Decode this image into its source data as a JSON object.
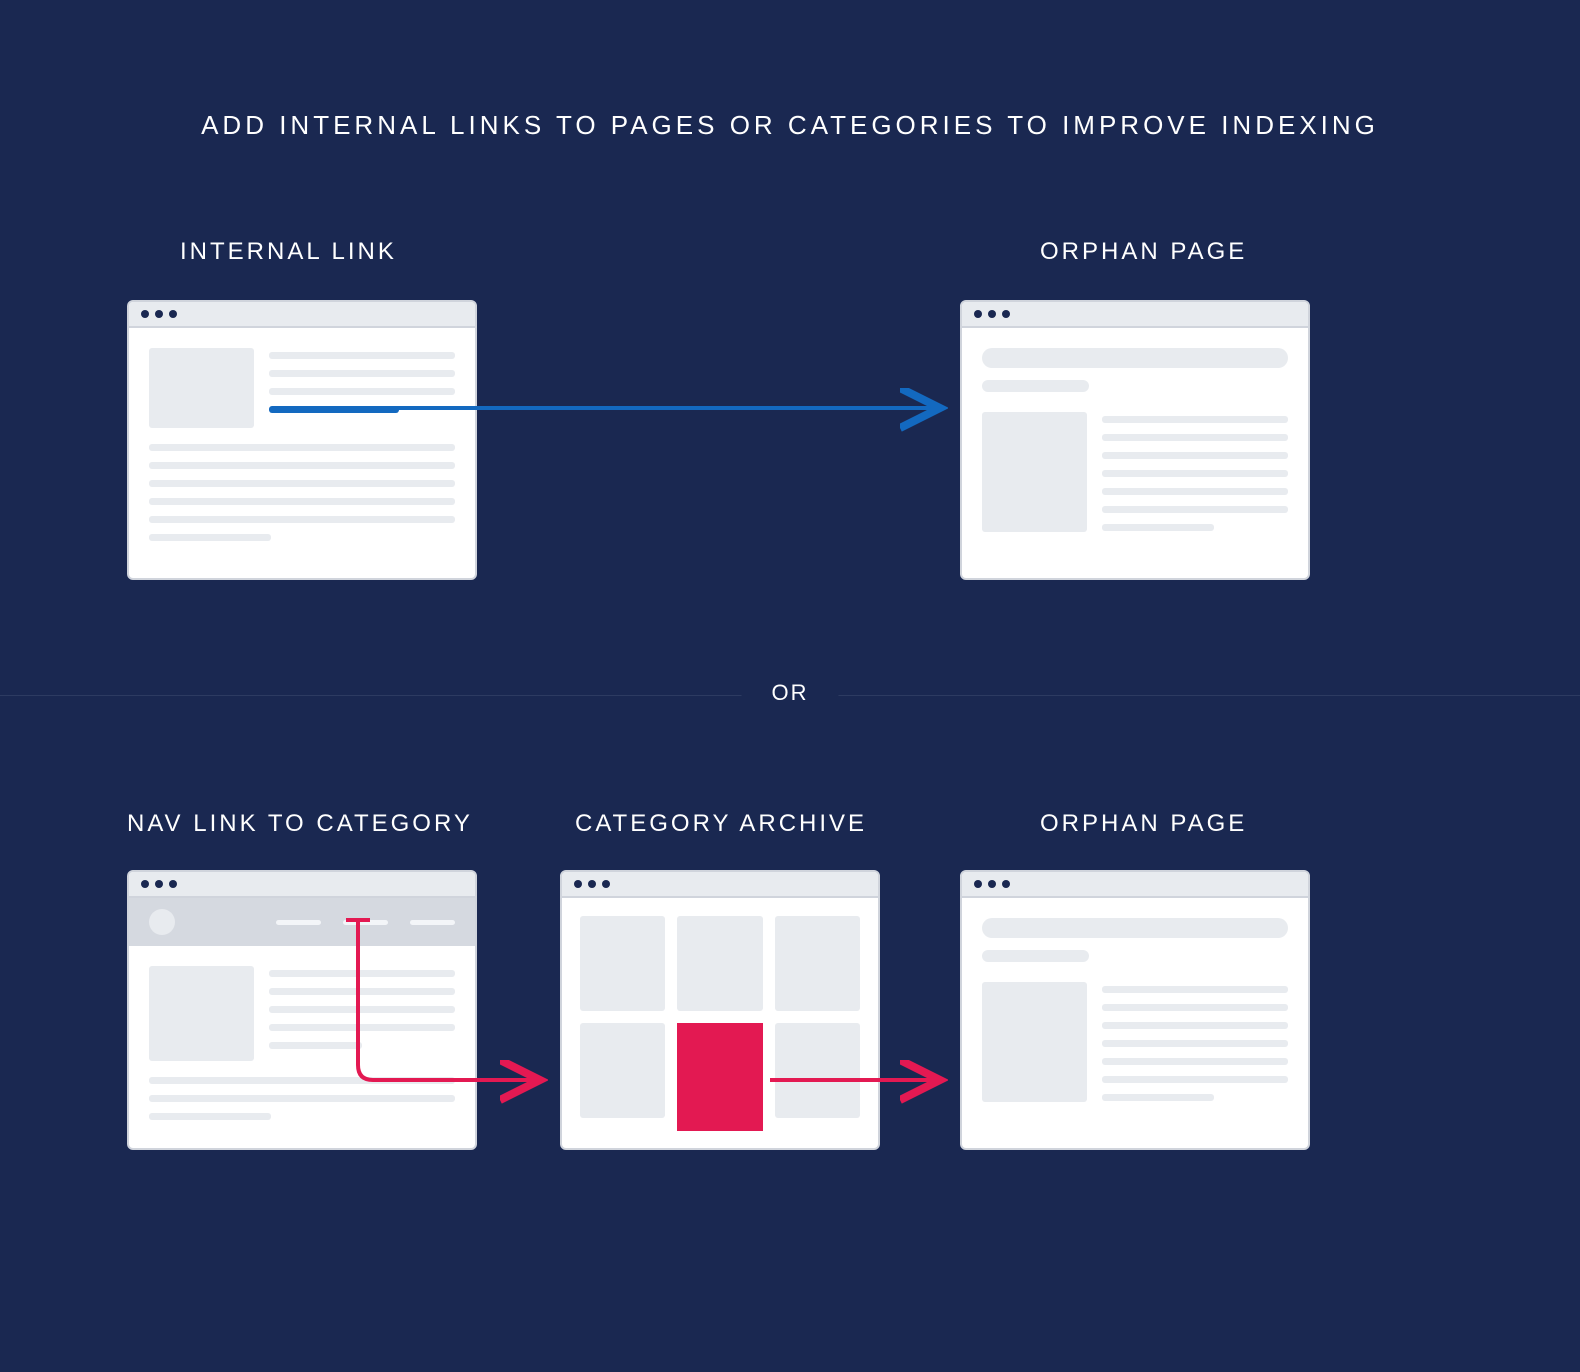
{
  "title": "ADD INTERNAL LINKS TO PAGES OR CATEGORIES TO IMPROVE INDEXING",
  "labels": {
    "internal_link": "INTERNAL LINK",
    "orphan_page_top": "ORPHAN PAGE",
    "nav_link": "NAV LINK TO CATEGORY",
    "category_archive": "CATEGORY ARCHIVE",
    "orphan_page_bottom": "ORPHAN PAGE"
  },
  "divider": "OR",
  "colors": {
    "background": "#1a2851",
    "arrow_blue": "#1369c0",
    "arrow_pink": "#e31952",
    "highlight_pink": "#e31952",
    "wireframe_fill": "#e8ebef"
  }
}
